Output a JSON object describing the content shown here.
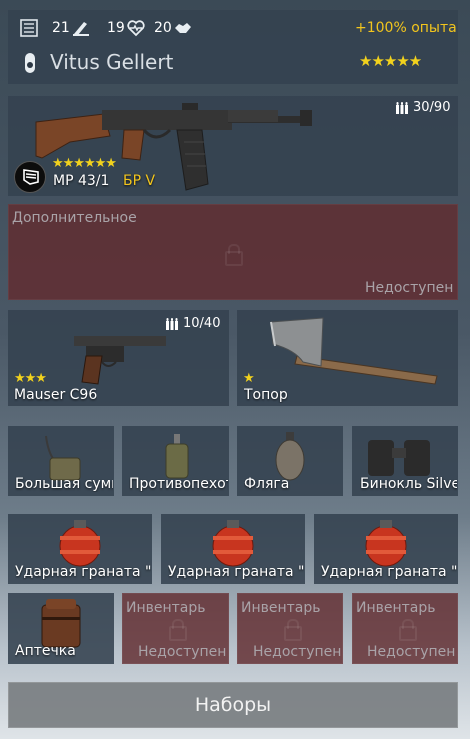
{
  "header": {
    "stat_kills": "21",
    "stat_hearts": "19",
    "stat_assists": "20",
    "bonus": "+100% опыта",
    "soldier_name": "Vitus Gellert",
    "soldier_stars": "★★★★★"
  },
  "primary": {
    "ammo": "30/90",
    "stars": "★★★★★★",
    "name": "MP 43/1",
    "br": "БР V"
  },
  "extra": {
    "label": "Дополнительное",
    "status": "Недоступен"
  },
  "secondary": [
    {
      "ammo": "10/40",
      "stars": "★★★",
      "name": "Mauser C96"
    },
    {
      "stars": "★",
      "name": "Топор"
    }
  ],
  "equipment": [
    {
      "name": "Большая сумка"
    },
    {
      "name": "Противопехотная мина"
    },
    {
      "name": "Фляга"
    },
    {
      "name": "Бинокль Silverman"
    }
  ],
  "grenades": [
    {
      "name": "Ударная граната \""
    },
    {
      "name": "Ударная граната \""
    },
    {
      "name": "Ударная граната \""
    }
  ],
  "inventory": {
    "first": "Аптечка",
    "locked_label": "Инвентарь",
    "locked_status": "Недоступен"
  },
  "footer": {
    "kits_button": "Наборы"
  }
}
